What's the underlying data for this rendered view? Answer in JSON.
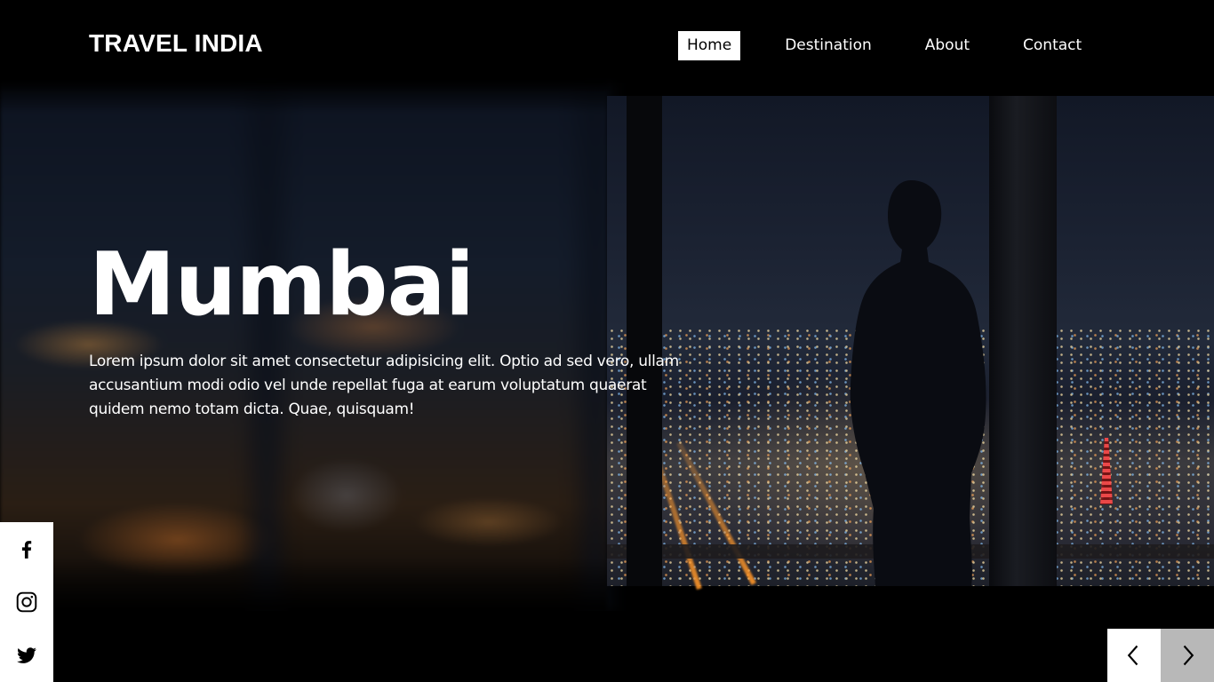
{
  "brand": {
    "logo_text": "TRAVEL INDIA"
  },
  "nav": {
    "items": [
      {
        "label": "Home",
        "active": true
      },
      {
        "label": "Destination",
        "active": false
      },
      {
        "label": "About",
        "active": false
      },
      {
        "label": "Contact",
        "active": false
      }
    ]
  },
  "hero": {
    "title": "Mumbai",
    "description": "Lorem ipsum dolor sit amet consectetur adipisicing elit. Optio ad sed vero, ullam accusantium modi odio vel unde repellat fuga at earum voluptatum quaerat quidem nemo totam dicta. Quae, quisquam!"
  },
  "social": {
    "icons": [
      "facebook-icon",
      "instagram-icon",
      "twitter-icon"
    ]
  },
  "slider": {
    "icons": [
      "chevron-left-icon",
      "chevron-right-icon"
    ]
  },
  "colors": {
    "background": "#000000",
    "text": "#ffffff",
    "nav_active_bg": "#ffffff",
    "nav_active_text": "#000000",
    "next_button_bg": "#b8b8b8"
  }
}
